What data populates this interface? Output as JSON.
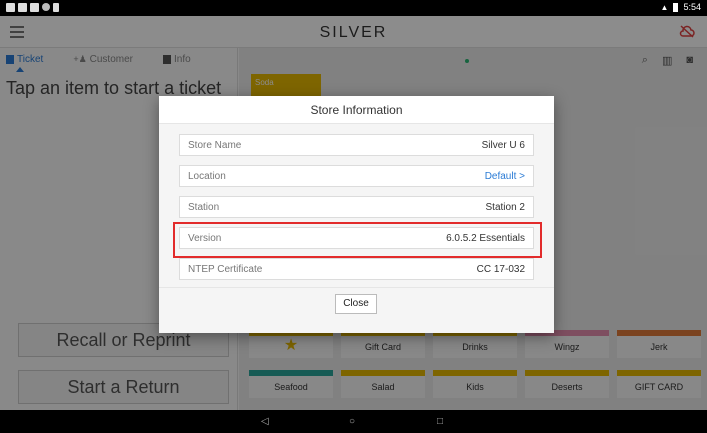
{
  "statusbar": {
    "time": "5:54"
  },
  "app": {
    "logo": "SILVER"
  },
  "left": {
    "tabs": [
      {
        "label": "Ticket"
      },
      {
        "label": "Customer"
      },
      {
        "label": "Info"
      }
    ],
    "tap_message": "Tap an item to start a ticket",
    "recall_label": "Recall or Reprint",
    "return_label": "Start a Return"
  },
  "right": {
    "soda_label": "Soda",
    "tiles": [
      {
        "label": "",
        "icon": "star-icon",
        "color": "#e6b800"
      },
      {
        "label": "Gift Card",
        "color": "#e6b800"
      },
      {
        "label": "Drinks",
        "color": "#e6b800"
      },
      {
        "label": "Wingz",
        "color": "#e58fb0"
      },
      {
        "label": "Jerk",
        "color": "#e07b39"
      },
      {
        "label": "Seafood",
        "color": "#2aa79b"
      },
      {
        "label": "Salad",
        "color": "#e6b800"
      },
      {
        "label": "Kids",
        "color": "#e6b800"
      },
      {
        "label": "Deserts",
        "color": "#e6b800"
      },
      {
        "label": "GIFT CARD",
        "color": "#e6b800"
      }
    ]
  },
  "dialog": {
    "title": "Store Information",
    "rows": [
      {
        "label": "Store Name",
        "value": "Silver U 6"
      },
      {
        "label": "Location",
        "value": "Default >"
      },
      {
        "label": "Station",
        "value": "Station 2"
      },
      {
        "label": "Version",
        "value": "6.0.5.2 Essentials"
      },
      {
        "label": "NTEP Certificate",
        "value": "CC 17-032"
      }
    ],
    "close_label": "Close"
  },
  "colors": {
    "accent": "#2a7bd5",
    "highlight": "#e22b2b",
    "tile_yellow": "#e6b800"
  }
}
